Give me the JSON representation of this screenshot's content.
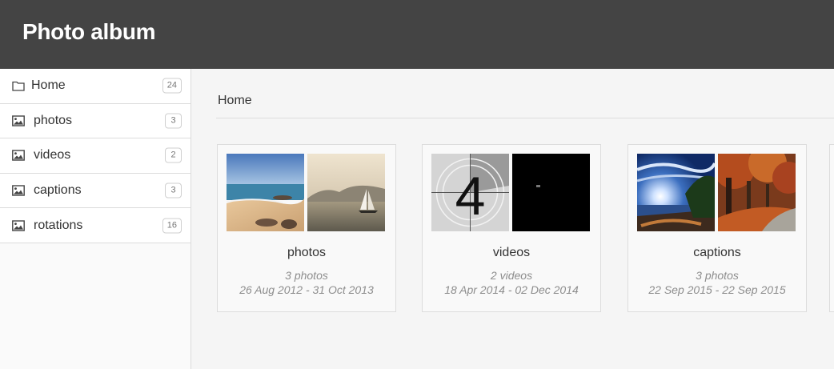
{
  "app": {
    "title": "Photo album"
  },
  "sidebar": {
    "items": [
      {
        "label": "Home",
        "count": "24",
        "icon": "folder-icon"
      },
      {
        "label": "photos",
        "count": "3",
        "icon": "image-icon"
      },
      {
        "label": "videos",
        "count": "2",
        "icon": "image-icon"
      },
      {
        "label": "captions",
        "count": "3",
        "icon": "image-icon"
      },
      {
        "label": "rotations",
        "count": "16",
        "icon": "image-icon"
      }
    ]
  },
  "main": {
    "breadcrumb": "Home",
    "albums": [
      {
        "name": "photos",
        "count": "3 photos",
        "dates": "26 Aug 2012 - 31 Oct 2013"
      },
      {
        "name": "videos",
        "count": "2 videos",
        "dates": "18 Apr 2014 - 02 Dec 2014"
      },
      {
        "name": "captions",
        "count": "3 photos",
        "dates": "22 Sep 2015 - 22 Sep 2015"
      }
    ]
  },
  "colors": {
    "header": "#444444",
    "sidebar_bg": "#fafafa",
    "main_bg": "#f5f5f5",
    "border": "#dcdcdc",
    "muted_text": "#8d8d8d"
  }
}
